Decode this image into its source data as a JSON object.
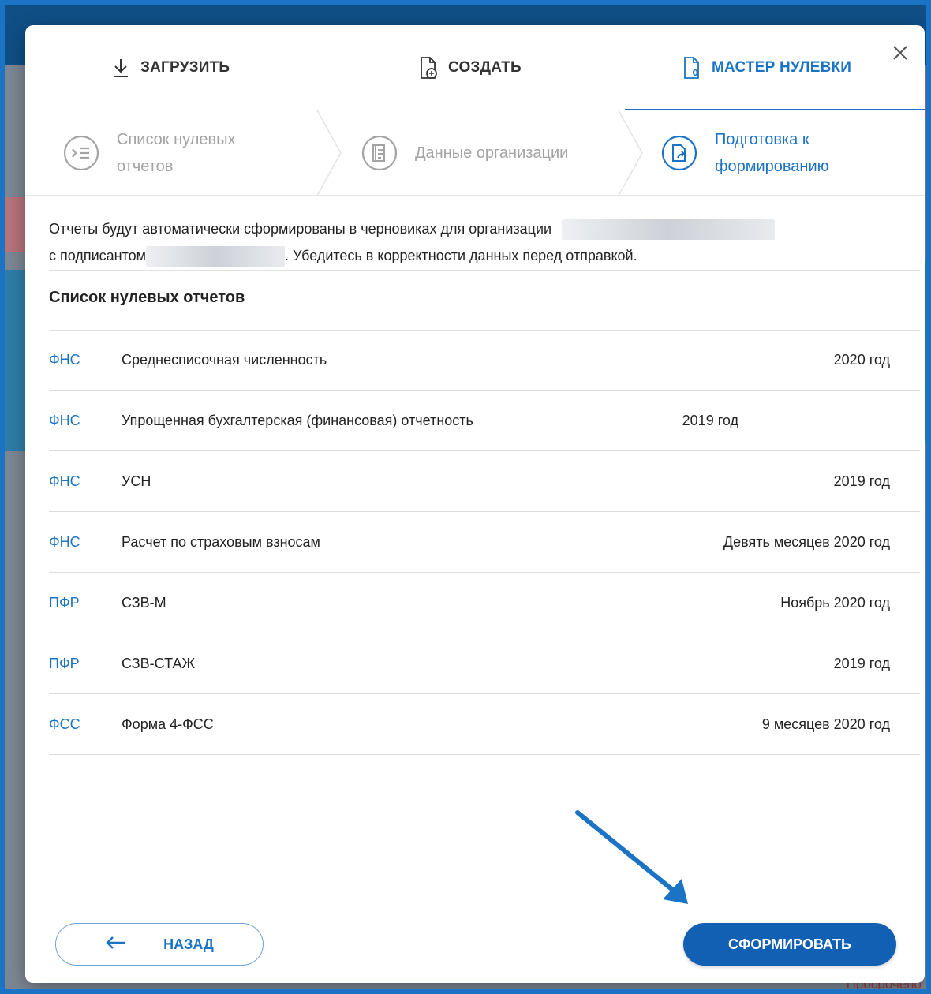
{
  "background": {
    "status_text": "Просрочено"
  },
  "colors": {
    "accent": "#1a73c5",
    "primary_button": "#1160b4",
    "inactive_step": "#a3a3a3"
  },
  "tabs": [
    {
      "label": "ЗАГРУЗИТЬ",
      "icon": "download-icon",
      "active": false
    },
    {
      "label": "СОЗДАТЬ",
      "icon": "create-document-icon",
      "active": false
    },
    {
      "label": "МАСТЕР НУЛЕВКИ",
      "icon": "zero-document-icon",
      "active": true
    }
  ],
  "steps": [
    {
      "line1": "Список нулевых",
      "line2": "отчетов",
      "icon": "list-icon",
      "state": "done"
    },
    {
      "line1": "Данные организации",
      "line2": "",
      "icon": "organization-data-icon",
      "state": "done"
    },
    {
      "line1": "Подготовка к",
      "line2": "формированию",
      "icon": "document-send-icon",
      "state": "active"
    }
  ],
  "notice": {
    "part1": "Отчеты будут автоматически сформированы в черновиках для организации",
    "part2": "с подписантом",
    "part3": ". Убедитесь в корректности данных перед отправкой."
  },
  "list_title": "Список нулевых отчетов",
  "reports": [
    {
      "agency": "ФНС",
      "name": "Среднесписочная численность",
      "period": "2020 год"
    },
    {
      "agency": "ФНС",
      "name": "Упрощенная бухгалтерская (финансовая) отчетность",
      "period": "2019 год"
    },
    {
      "agency": "ФНС",
      "name": "УСН",
      "period": "2019 год"
    },
    {
      "agency": "ФНС",
      "name": "Расчет по страховым взносам",
      "period": "Девять месяцев 2020 год"
    },
    {
      "agency": "ПФР",
      "name": "СЗВ-М",
      "period": "Ноябрь 2020 год"
    },
    {
      "agency": "ПФР",
      "name": "СЗВ-СТАЖ",
      "period": "2019 год"
    },
    {
      "agency": "ФСС",
      "name": "Форма 4-ФСС",
      "period": "9 месяцев 2020 год"
    }
  ],
  "buttons": {
    "back": "НАЗАД",
    "submit": "СФОРМИРОВАТЬ"
  }
}
